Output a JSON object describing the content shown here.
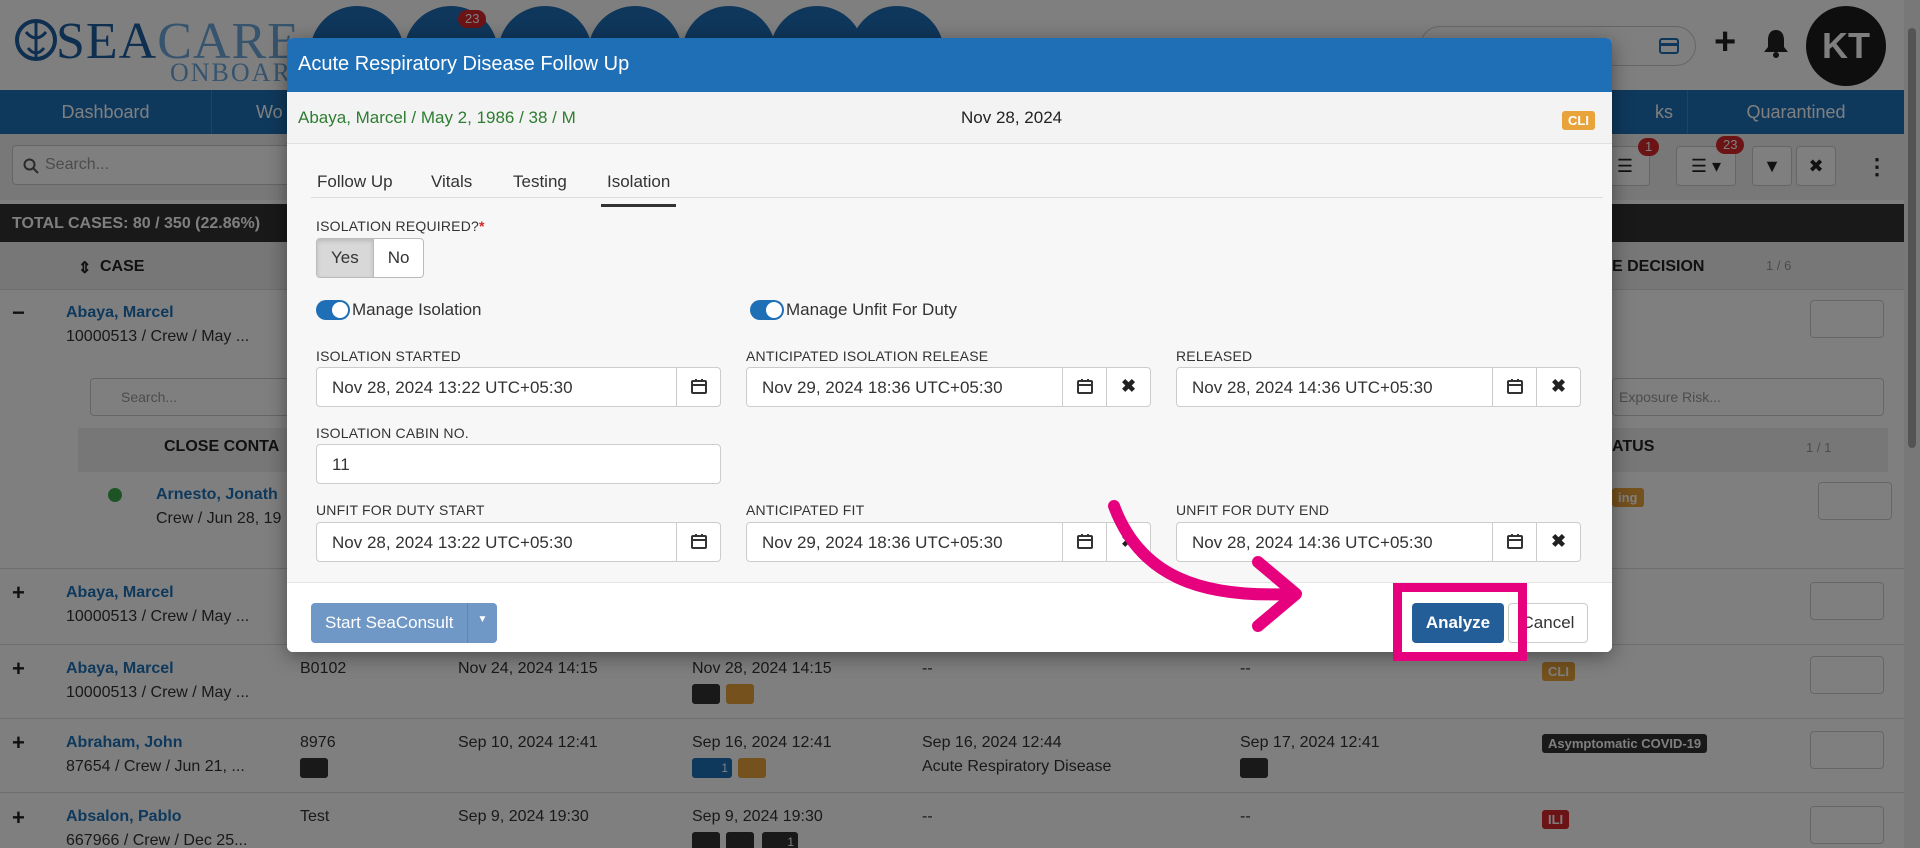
{
  "header": {
    "logo_main_1": "SEA",
    "logo_main_2": "CARE",
    "logo_sub": "ONBOARD",
    "notification_badge": "23",
    "avatar_initials": "KT"
  },
  "nav": {
    "items": [
      "Dashboard",
      "Wo",
      "ks",
      "Quarantined"
    ]
  },
  "toolbar": {
    "search_placeholder": "Search...",
    "filter_badge": "1",
    "list_badge": "23"
  },
  "table": {
    "totals": "TOTAL CASES: 80 / 350 (22.86%)",
    "col_case": "CASE",
    "col_decision": "E DECISION",
    "pager": "1 / 6",
    "sub_search_placeholder": "Search...",
    "sub_exposure_placeholder": "Exposure Risk...",
    "sub_col_close": "CLOSE CONTA",
    "sub_col_status": "ATUS",
    "sub_pager": "1 / 1",
    "sub_status_pill": "ing",
    "rows": [
      {
        "name": "Abaya, Marcel",
        "detail": "10000513 / Crew / May ..."
      },
      {
        "name": "Arnesto, Jonath",
        "detail": "Crew / Jun 28, 19"
      },
      {
        "name": "Abaya, Marcel",
        "detail": "10000513 / Crew / May ..."
      },
      {
        "name": "Abaya, Marcel",
        "detail": "10000513 / Crew / May ...",
        "cabin": "B0102",
        "c1": "Nov 24, 2024 14:15",
        "c2": "Nov 28, 2024 14:15",
        "c3": "--",
        "c4": "--",
        "pill": "CLI"
      },
      {
        "name": "Abraham, John",
        "detail": "87654 / Crew / Jun 21, ...",
        "cabin": "8976",
        "c1": "Sep 10, 2024 12:41",
        "c2": "Sep 16, 2024 12:41",
        "c2_badge": "1",
        "c3": "Sep 16, 2024 12:44",
        "c3b": "Acute Respiratory Disease",
        "c4": "Sep 17, 2024 12:41",
        "pill": "Asymptomatic COVID-19"
      },
      {
        "name": "Absalon, Pablo",
        "detail": "667966 / Crew / Dec 25...",
        "cabin": "Test",
        "c1": "Sep 9, 2024 19:30",
        "c2": "Sep 9, 2024 19:30",
        "c2_badge": "1",
        "c3": "--",
        "c4": "--",
        "pill": "ILI"
      }
    ]
  },
  "modal": {
    "title": "Acute Respiratory Disease Follow Up",
    "patient": "Abaya, Marcel / May 2, 1986 / 38 / M",
    "date": "Nov 28, 2024",
    "badge": "CLI",
    "tabs": [
      "Follow Up",
      "Vitals",
      "Testing",
      "Isolation"
    ],
    "isolation_required_label": "ISOLATION REQUIRED?",
    "required_mark": "*",
    "yes_label": "Yes",
    "no_label": "No",
    "manage_isolation_label": "Manage Isolation",
    "manage_unfit_label": "Manage Unfit For Duty",
    "isolation_started_label": "ISOLATION STARTED",
    "isolation_started_value": "Nov 28, 2024 13:22 UTC+05:30",
    "anticipated_release_label": "ANTICIPATED ISOLATION RELEASE",
    "anticipated_release_value": "Nov 29, 2024 18:36 UTC+05:30",
    "released_label": "RELEASED",
    "released_value": "Nov 28, 2024 14:36 UTC+05:30",
    "cabin_label": "ISOLATION CABIN NO.",
    "cabin_value": "11",
    "unfit_start_label": "UNFIT FOR DUTY START",
    "unfit_start_value": "Nov 28, 2024 13:22 UTC+05:30",
    "anticipated_fit_label": "ANTICIPATED FIT",
    "anticipated_fit_value": "Nov 29, 2024 18:36 UTC+05:30",
    "unfit_end_label": "UNFIT FOR DUTY END",
    "unfit_end_value": "Nov 28, 2024 14:36 UTC+05:30",
    "start_consult_label": "Start SeaConsult",
    "analyze_label": "Analyze",
    "cancel_label": "Cancel"
  },
  "colors": {
    "primary_blue": "#1f6fb7",
    "analyze_blue": "#245e99",
    "highlight_pink": "#e6007e",
    "cli_orange": "#e8a33a",
    "patient_green": "#2e7d32"
  }
}
